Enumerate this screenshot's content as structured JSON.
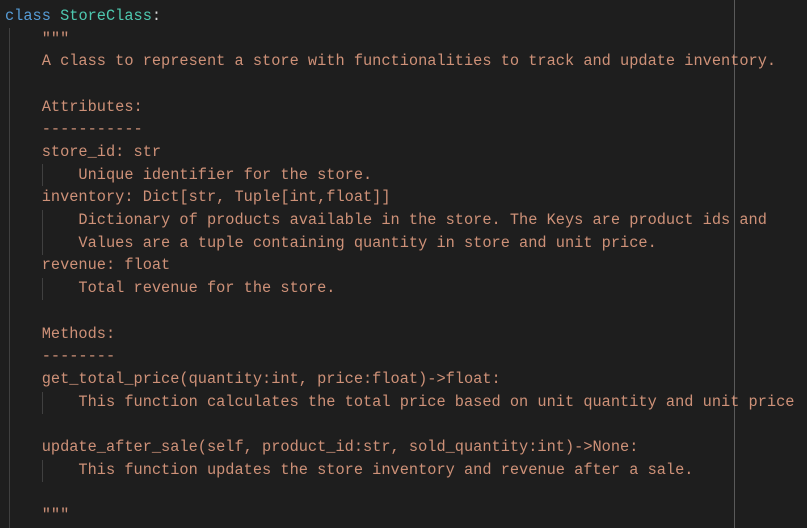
{
  "code": {
    "keyword": "class",
    "class_name": "StoreClass",
    "colon": ":",
    "lines": [
      "    \"\"\"",
      "    A class to represent a store with functionalities to track and update inventory.",
      "",
      "    Attributes:",
      "    -----------",
      "    store_id: str",
      "        Unique identifier for the store.",
      "    inventory: Dict[str, Tuple[int,float]]",
      "        Dictionary of products available in the store. The Keys are product ids and",
      "        Values are a tuple containing quantity in store and unit price.",
      "    revenue: float",
      "        Total revenue for the store.",
      "",
      "    Methods:",
      "    --------",
      "    get_total_price(quantity:int, price:float)->float:",
      "        This function calculates the total price based on unit quantity and unit price",
      "",
      "    update_after_sale(self, product_id:str, sold_quantity:int)->None:",
      "        This function updates the store inventory and revenue after a sale.",
      "",
      "    \"\"\""
    ]
  },
  "colors": {
    "background": "#1e1e1e",
    "keyword": "#569cd6",
    "class_name": "#4ec9b0",
    "string": "#ce9178"
  }
}
